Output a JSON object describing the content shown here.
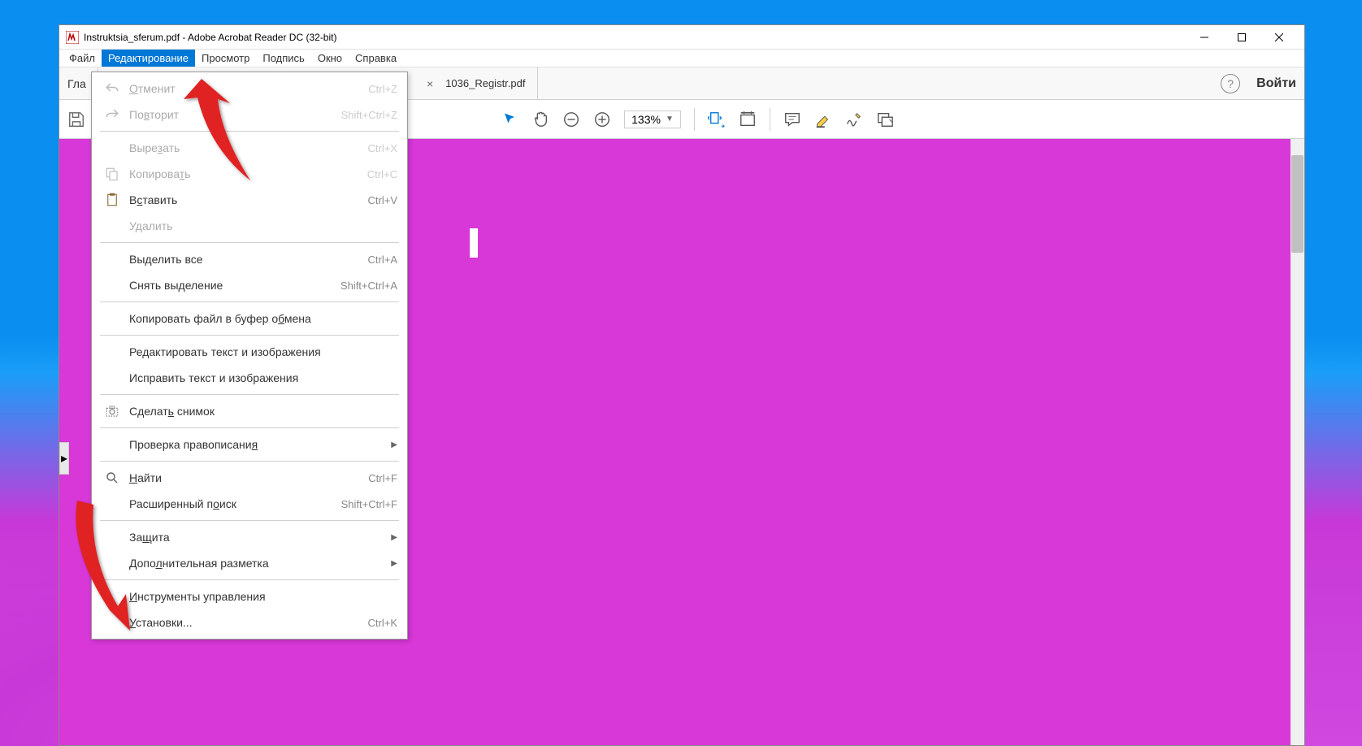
{
  "window": {
    "title": "Instruktsia_sferum.pdf - Adobe Acrobat Reader DC (32-bit)"
  },
  "menubar": {
    "file": "Файл",
    "edit": "Редактирование",
    "view": "Просмотр",
    "sign": "Подпись",
    "window": "Окно",
    "help": "Справка"
  },
  "tabs": {
    "home": "Гла",
    "tab1": "1036_Registr.pdf",
    "tab1_close": "×"
  },
  "header": {
    "help": "?",
    "login": "Войти"
  },
  "toolbar": {
    "zoom": "133%"
  },
  "edit_menu": {
    "undo": {
      "label": "Отменит",
      "shortcut": "Ctrl+Z"
    },
    "redo": {
      "label": "Повторит",
      "shortcut": "Shift+Ctrl+Z"
    },
    "cut": {
      "label": "Вырезать",
      "shortcut": "Ctrl+X"
    },
    "copy": {
      "label": "Копировать",
      "shortcut": "Ctrl+C"
    },
    "paste": {
      "label": "Вставить",
      "shortcut": "Ctrl+V"
    },
    "delete": {
      "label": "Удалить"
    },
    "select_all": {
      "label": "Выделить все",
      "shortcut": "Ctrl+A"
    },
    "deselect": {
      "label": "Снять выделение",
      "shortcut": "Shift+Ctrl+A"
    },
    "copy_to_clipboard": {
      "label": "Копировать файл в буфер обмена"
    },
    "edit_text_images": {
      "label": "Редактировать текст и изображения"
    },
    "fix_text_images": {
      "label": "Исправить текст и изображения"
    },
    "snapshot": {
      "label": "Сделать снимок"
    },
    "spellcheck": {
      "label": "Проверка правописания"
    },
    "find": {
      "label": "Найти",
      "shortcut": "Ctrl+F"
    },
    "adv_search": {
      "label": "Расширенный поиск",
      "shortcut": "Shift+Ctrl+F"
    },
    "protect": {
      "label": "Защита"
    },
    "accessibility": {
      "label": "Дополнительная разметка"
    },
    "manage_tools": {
      "label": "Инструменты управления"
    },
    "preferences": {
      "label": "Установки...",
      "shortcut": "Ctrl+K"
    }
  }
}
